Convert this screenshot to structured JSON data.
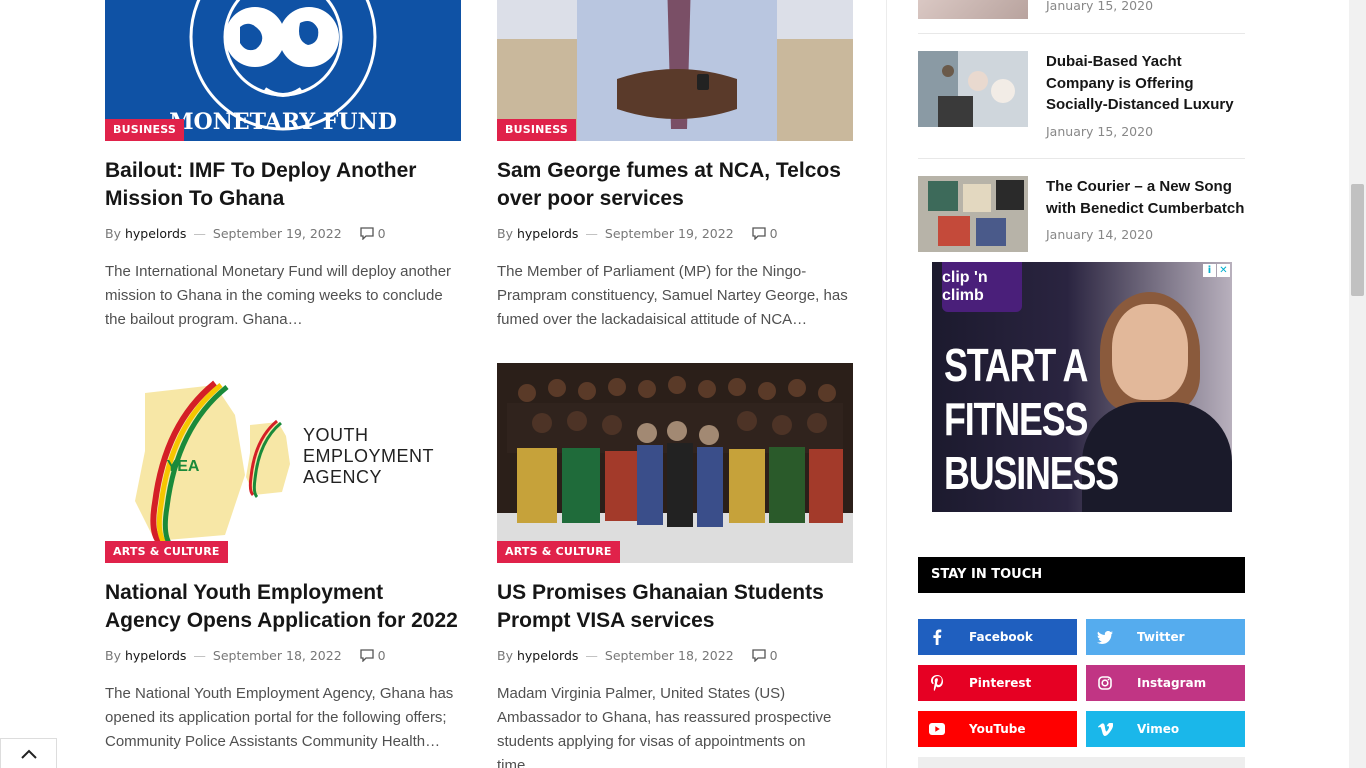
{
  "posts": [
    {
      "category": "BUSINESS",
      "title": "Bailout: IMF To Deploy Another Mission To Ghana",
      "by": "By",
      "author": "hypelords",
      "date": "September 19, 2022",
      "comments": "0",
      "excerpt": "The International Monetary Fund will deploy another mission to Ghana in the coming weeks to conclude the bailout program. Ghana…",
      "image_text": "INTERNATIONAL MONETARY FUND"
    },
    {
      "category": "BUSINESS",
      "title": "Sam George fumes at NCA, Telcos over poor services",
      "by": "By",
      "author": "hypelords",
      "date": "September 19, 2022",
      "comments": "0",
      "excerpt": "The Member of Parliament (MP) for the Ningo-Prampram constituency, Samuel Nartey George, has fumed over the lackadaisical attitude of NCA…"
    },
    {
      "category": "ARTS & CULTURE",
      "title": "National Youth Employment Agency Opens Application for 2022",
      "by": "By",
      "author": "hypelords",
      "date": "September 18, 2022",
      "comments": "0",
      "excerpt": "The National Youth Employment Agency, Ghana has opened its application portal for the following offers; Community Police Assistants Community Health…",
      "image_text": [
        "YOUTH",
        "EMPLOYMENT",
        "AGENCY"
      ]
    },
    {
      "category": "ARTS & CULTURE",
      "title": "US Promises Ghanaian Students Prompt VISA services",
      "by": "By",
      "author": "hypelords",
      "date": "September 18, 2022",
      "comments": "0",
      "excerpt": "Madam Virginia Palmer, United States (US) Ambassador to Ghana, has reassured prospective students applying for visas of appointments on time…"
    }
  ],
  "sidebar": {
    "posts": [
      {
        "title": "",
        "date": "January 15, 2020"
      },
      {
        "title": "Dubai-Based Yacht Company is Offering Socially-Distanced Luxury",
        "date": "January 15, 2020"
      },
      {
        "title": "The Courier – a New Song with Benedict Cumberbatch",
        "date": "January 14, 2020"
      }
    ],
    "ad": {
      "brand": "clip 'n climb",
      "headline": "START A FITNESS BUSINESS"
    },
    "stay_in_touch": {
      "title": "STAY IN TOUCH",
      "networks": [
        {
          "label": "Facebook",
          "icon": "facebook-icon",
          "color": "#1f5fbf"
        },
        {
          "label": "Twitter",
          "icon": "twitter-icon",
          "color": "#55acee"
        },
        {
          "label": "Pinterest",
          "icon": "pinterest-icon",
          "color": "#e60023"
        },
        {
          "label": "Instagram",
          "icon": "instagram-icon",
          "color": "#c13584"
        },
        {
          "label": "YouTube",
          "icon": "youtube-icon",
          "color": "#ff0000"
        },
        {
          "label": "Vimeo",
          "icon": "vimeo-icon",
          "color": "#1ab7ea"
        }
      ]
    }
  },
  "colors": {
    "category_badge": "#e0224a",
    "accent_text": "#161616"
  }
}
